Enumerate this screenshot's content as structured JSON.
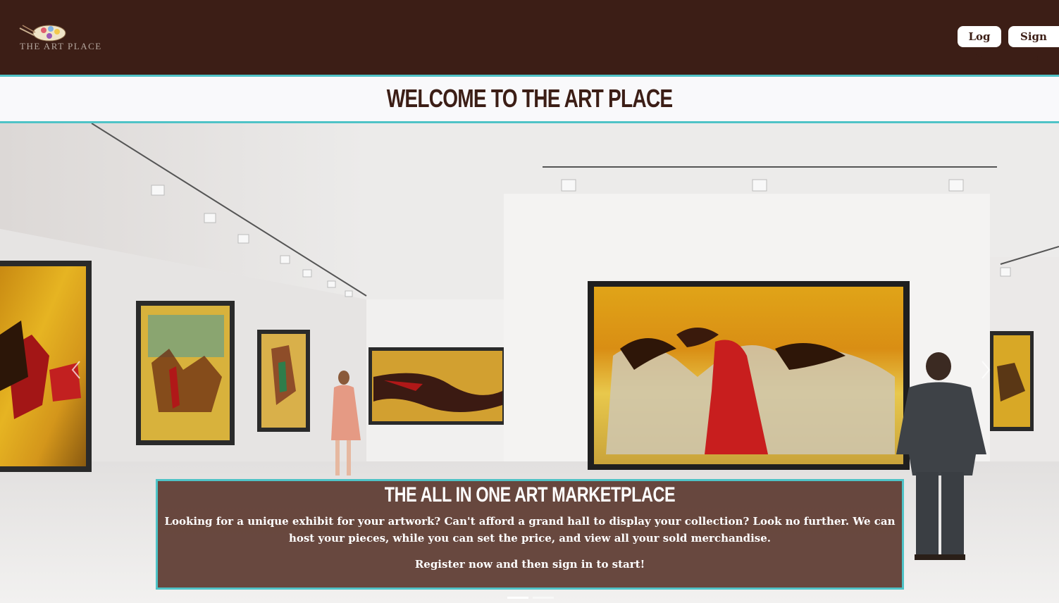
{
  "brand": {
    "name": "THE ART PLACE",
    "logo_icon": "palette-icon"
  },
  "nav": {
    "login_label": "Log in",
    "signup_label": "Sign Up"
  },
  "welcome": {
    "title": "WELCOME TO THE ART PLACE"
  },
  "carousel": {
    "prev_icon": "chevron-left-icon",
    "next_icon": "chevron-right-icon",
    "caption": {
      "title": "THE ALL IN ONE ART MARKETPLACE",
      "body": "Looking for a unique exhibit for your artwork? Can't afford a grand hall to display your collection? Look no further. We can host your pieces, while you can set the price, and view all your sold merchandise.",
      "cta": "Register now and then sign in to start!"
    },
    "slide_count": 2,
    "active_slide": 1
  },
  "colors": {
    "navbar_bg": "#3c1e16",
    "accent": "#4fc3c7",
    "caption_bg": "#5c3a30",
    "title_text": "#3c1e16"
  }
}
